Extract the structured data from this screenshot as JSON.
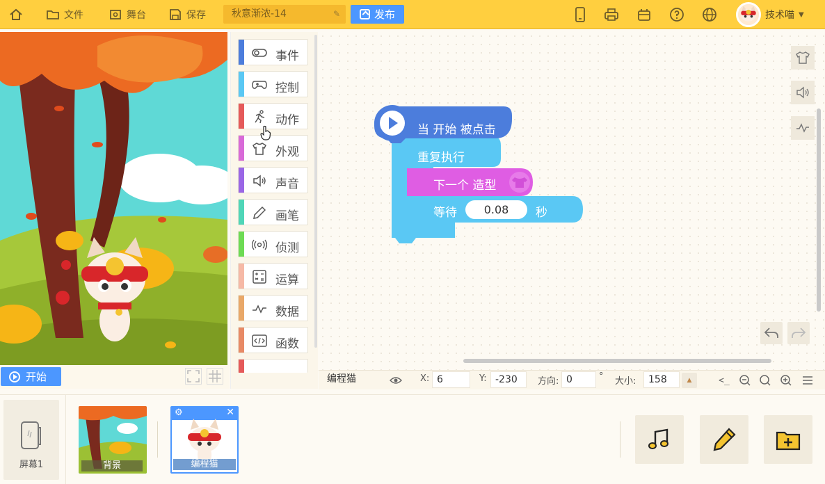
{
  "topbar": {
    "home_label": "",
    "file_label": "文件",
    "stage_label": "舞台",
    "save_label": "保存",
    "project_name": "秋意渐浓-14",
    "publish_label": "发布",
    "username": "技术喵"
  },
  "stage": {
    "start_label": "开始"
  },
  "categories": [
    {
      "label": "事件",
      "color": "#4c7ddc",
      "icon": "toggle-icon"
    },
    {
      "label": "控制",
      "color": "#5ac8f4",
      "icon": "gamepad-icon"
    },
    {
      "label": "动作",
      "color": "#e55a5a",
      "icon": "running-icon"
    },
    {
      "label": "外观",
      "color": "#d86ad8",
      "icon": "shirt-icon"
    },
    {
      "label": "声音",
      "color": "#9a66e6",
      "icon": "speaker-icon"
    },
    {
      "label": "画笔",
      "color": "#4fd6b8",
      "icon": "pencil-icon"
    },
    {
      "label": "侦测",
      "color": "#6ddb54",
      "icon": "radar-icon"
    },
    {
      "label": "运算",
      "color": "#f6b9a6",
      "icon": "calculator-icon"
    },
    {
      "label": "数据",
      "color": "#e9a869",
      "icon": "pulse-icon"
    },
    {
      "label": "函数",
      "color": "#e88a66",
      "icon": "code-icon"
    }
  ],
  "blocks": {
    "when_flag": "当 开始 被点击",
    "repeat": "重复执行",
    "next_costume": "下一个 造型",
    "wait_label": "等待",
    "wait_value": "0.08",
    "wait_unit": "秒"
  },
  "sprite": {
    "name": "编程猫",
    "x_label": "X:",
    "x_value": "6",
    "y_label": "Y:",
    "y_value": "-230",
    "dir_label": "方向:",
    "dir_value": "0",
    "dir_unit": "°",
    "size_label": "大小:",
    "size_value": "158"
  },
  "bottom": {
    "screen_label": "屏幕1",
    "background_label": "背景",
    "sprite_label": "编程猫"
  },
  "colors": {
    "topbar": "#ffcf3f",
    "accent": "#4c97ff",
    "event_block": "#4c7ddc",
    "control_block": "#5ac8f4",
    "looks_block": "#d86ad8"
  }
}
